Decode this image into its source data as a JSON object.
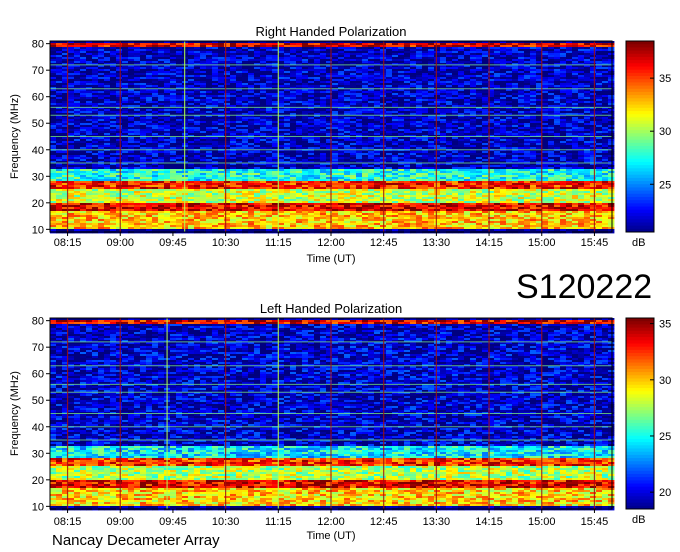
{
  "figure": {
    "code": "S120222",
    "brand": "Nancay Decameter Array"
  },
  "palette": [
    "#00007f",
    "#0000ff",
    "#0080ff",
    "#00ffff",
    "#80ff80",
    "#ffff00",
    "#ff8000",
    "#ff0000",
    "#7f0000"
  ],
  "chart_data": [
    {
      "type": "heatmap",
      "title": "Right Handed Polarization",
      "xlabel": "Time (UT)",
      "ylabel": "Frequency (MHz)",
      "x_tick_labels": [
        "08:15",
        "09:00",
        "09:45",
        "10:30",
        "11:15",
        "12:00",
        "12:45",
        "13:30",
        "14:15",
        "15:00",
        "15:45"
      ],
      "x_range_hours": [
        8.0,
        16.0
      ],
      "y_ticks": [
        10,
        20,
        30,
        40,
        50,
        60,
        70,
        80
      ],
      "ylim": [
        9,
        81
      ],
      "colorbar": {
        "label": "dB",
        "ticks": [
          25,
          30,
          35
        ],
        "range": [
          20.5,
          38.5
        ]
      },
      "strong_bands_MHz": [
        {
          "from": 10,
          "to": 17,
          "level_dB": 33
        },
        {
          "from": 17,
          "to": 20,
          "level_dB": 37
        },
        {
          "from": 20,
          "to": 25,
          "level_dB": 31
        },
        {
          "from": 25,
          "to": 28,
          "level_dB": 36
        },
        {
          "from": 28,
          "to": 33,
          "level_dB": 28
        },
        {
          "from": 33,
          "to": 79,
          "level_dB": 22
        },
        {
          "from": 79,
          "to": 80,
          "level_dB": 37
        }
      ],
      "narrowband_lines_MHz": [
        35,
        40,
        45,
        53,
        56,
        63,
        72
      ],
      "vertical_lines_UT": [
        "08:15",
        "09:00",
        "09:55",
        "10:30",
        "11:15",
        "12:00",
        "12:45",
        "13:30",
        "14:15",
        "15:00",
        "15:45"
      ]
    },
    {
      "type": "heatmap",
      "title": "Left Handed Polarization",
      "xlabel": "Time (UT)",
      "ylabel": "Frequency (MHz)",
      "x_tick_labels": [
        "08:15",
        "09:00",
        "09:45",
        "10:30",
        "11:15",
        "12:00",
        "12:45",
        "13:30",
        "14:15",
        "15:00",
        "15:45"
      ],
      "x_range_hours": [
        8.0,
        16.0
      ],
      "y_ticks": [
        10,
        20,
        30,
        40,
        50,
        60,
        70,
        80
      ],
      "ylim": [
        9,
        81
      ],
      "colorbar": {
        "label": "dB",
        "ticks": [
          20,
          25,
          30,
          35
        ],
        "range": [
          18.5,
          35.5
        ]
      },
      "strong_bands_MHz": [
        {
          "from": 10,
          "to": 17,
          "level_dB": 30
        },
        {
          "from": 17,
          "to": 20,
          "level_dB": 34
        },
        {
          "from": 20,
          "to": 25,
          "level_dB": 28
        },
        {
          "from": 25,
          "to": 28,
          "level_dB": 33
        },
        {
          "from": 28,
          "to": 33,
          "level_dB": 25
        },
        {
          "from": 33,
          "to": 79,
          "level_dB": 20
        },
        {
          "from": 79,
          "to": 80,
          "level_dB": 34
        }
      ],
      "narrowband_lines_MHz": [
        35,
        40,
        45,
        53,
        56,
        63,
        72
      ],
      "vertical_lines_UT": [
        "08:15",
        "09:00",
        "09:40",
        "10:30",
        "11:15",
        "12:00",
        "12:45",
        "13:30",
        "14:15",
        "15:00",
        "15:45"
      ]
    }
  ]
}
